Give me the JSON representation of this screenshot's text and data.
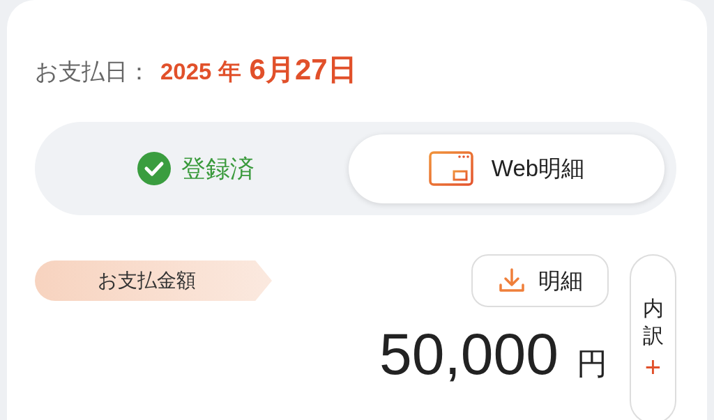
{
  "payment_date": {
    "label": "お支払日：",
    "year": "2025 年",
    "day": "6月27日"
  },
  "registration": {
    "status": "登録済",
    "checked": true
  },
  "web_statement_button": {
    "label": "Web明細"
  },
  "amount": {
    "tag": "お支払金額",
    "value": "50,000",
    "unit": "円"
  },
  "statement_button": {
    "label": "明細"
  },
  "breakdown_button": {
    "label": "内訳",
    "icon": "+",
    "expanded": false
  }
}
